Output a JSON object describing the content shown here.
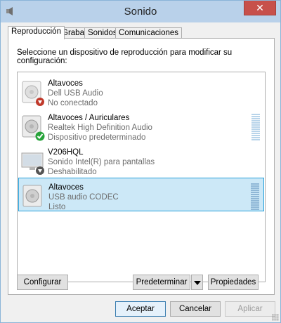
{
  "window": {
    "title": "Sonido",
    "close_glyph": "✕"
  },
  "tabs": [
    {
      "label": "Reproducción",
      "active": true
    },
    {
      "label": "Grabar",
      "active": false
    },
    {
      "label": "Sonidos",
      "active": false
    },
    {
      "label": "Comunicaciones",
      "active": false
    }
  ],
  "instruction": "Seleccione un dispositivo de reproducción para modificar su configuración:",
  "devices": [
    {
      "name": "Altavoces",
      "driver": "Dell USB Audio",
      "status": "No conectado",
      "icon": "speaker-icon",
      "badge": "disconnected-badge-icon",
      "badge_color": "#c0392b"
    },
    {
      "name": "Altavoces / Auriculares",
      "driver": "Realtek High Definition Audio",
      "status": "Dispositivo predeterminado",
      "icon": "speaker-icon",
      "badge": "default-check-badge-icon",
      "badge_color": "#27a33a"
    },
    {
      "name": "V206HQL",
      "driver": "Sonido Intel(R) para pantallas",
      "status": "Deshabilitado",
      "icon": "monitor-icon",
      "badge": "disabled-badge-icon",
      "badge_color": "#555555"
    },
    {
      "name": "Altavoces",
      "driver": "USB audio CODEC",
      "status": "Listo",
      "icon": "speaker-icon",
      "selected": true
    }
  ],
  "buttons": {
    "configure": "Configurar",
    "set_default": "Predeterminar",
    "properties": "Propiedades",
    "ok": "Aceptar",
    "cancel": "Cancelar",
    "apply": "Aplicar"
  },
  "colors": {
    "selection": "#cce8f7",
    "selection_border": "#26a0da",
    "titlebar": "#b9d1ea",
    "close": "#c7504b"
  }
}
